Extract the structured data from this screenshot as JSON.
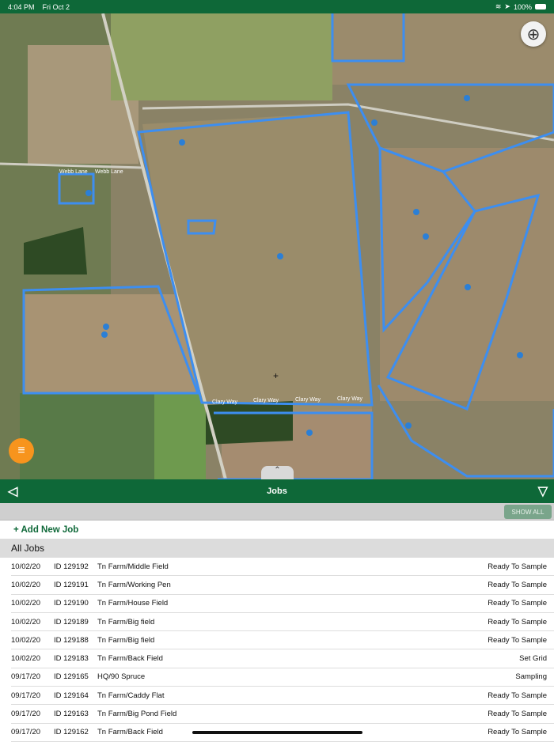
{
  "status_bar": {
    "time": "4:04 PM",
    "date": "Fri Oct 2",
    "battery": "100%"
  },
  "map": {
    "road_labels": [
      "Webb Lane",
      "Webb Lane",
      "Clary Way",
      "Clary Way",
      "Clary Way",
      "Clary Way"
    ],
    "boundary_color": "#3d8ef0",
    "pin_color": "#2b7fd6"
  },
  "nav": {
    "title": "Jobs"
  },
  "toolbar": {
    "show_all": "SHOW ALL"
  },
  "add_job": "+ Add New Job",
  "section_title": "All Jobs",
  "jobs": [
    {
      "date": "10/02/20",
      "id": "ID 129192",
      "name": "Tn Farm/Middle Field",
      "status": "Ready To Sample"
    },
    {
      "date": "10/02/20",
      "id": "ID 129191",
      "name": "Tn Farm/Working Pen",
      "status": "Ready To Sample"
    },
    {
      "date": "10/02/20",
      "id": "ID 129190",
      "name": "Tn Farm/House Field",
      "status": "Ready To Sample"
    },
    {
      "date": "10/02/20",
      "id": "ID 129189",
      "name": "Tn Farm/Big field",
      "status": "Ready To Sample"
    },
    {
      "date": "10/02/20",
      "id": "ID 129188",
      "name": "Tn Farm/Big field",
      "status": "Ready To Sample"
    },
    {
      "date": "10/02/20",
      "id": "ID 129183",
      "name": "Tn Farm/Back Field",
      "status": "Set Grid"
    },
    {
      "date": "09/17/20",
      "id": "ID 129165",
      "name": "HQ/90 Spruce",
      "status": "Sampling"
    },
    {
      "date": "09/17/20",
      "id": "ID 129164",
      "name": "Tn Farm/Caddy Flat",
      "status": "Ready To Sample"
    },
    {
      "date": "09/17/20",
      "id": "ID 129163",
      "name": "Tn Farm/Big Pond Field",
      "status": "Ready To Sample"
    },
    {
      "date": "09/17/20",
      "id": "ID 129162",
      "name": "Tn Farm/Back Field",
      "status": "Ready To Sample"
    }
  ]
}
